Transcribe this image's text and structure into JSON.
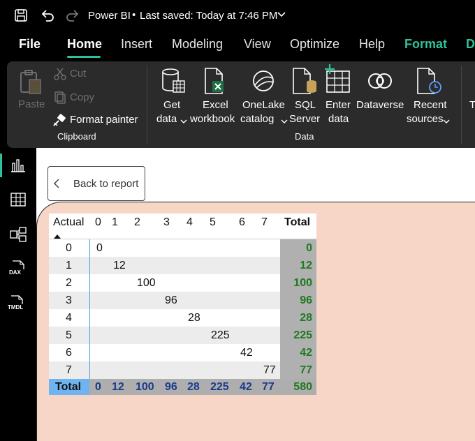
{
  "titlebar": {
    "app_title": "Power BI",
    "separator": "•",
    "saved_status": "Last saved: Today at 7:46 PM",
    "icons": [
      "save-icon",
      "undo-icon",
      "redo-icon",
      "chevron-down-icon"
    ]
  },
  "menu": {
    "items": [
      "File",
      "Home",
      "Insert",
      "Modeling",
      "View",
      "Optimize",
      "Help",
      "Format",
      "D"
    ],
    "active": "Home"
  },
  "ribbon": {
    "clipboard": {
      "paste": "Paste",
      "cut": "Cut",
      "copy": "Copy",
      "format_painter": "Format painter",
      "group": "Clipboard"
    },
    "data": {
      "get_data": [
        "Get",
        "data"
      ],
      "excel": [
        "Excel",
        "workbook"
      ],
      "onelake": [
        "OneLake",
        "catalog"
      ],
      "sql": [
        "SQL",
        "Server"
      ],
      "enter": [
        "Enter",
        "data"
      ],
      "dataverse": "Dataverse",
      "recent": [
        "Recent",
        "sources"
      ],
      "group": "Data"
    },
    "next_partial": "T"
  },
  "leftrail": {
    "icons": [
      "report-view-icon",
      "table-view-icon",
      "model-view-icon",
      "dax-query-icon",
      "tmdl-view-icon"
    ],
    "dax_text": "DAX",
    "tmdl_text": "TMDL"
  },
  "back_button": {
    "label": "Back to report"
  },
  "matrix": {
    "row_header": "Actual",
    "columns": [
      "0",
      "1",
      "2",
      "3",
      "4",
      "5",
      "6",
      "7"
    ],
    "total_label": "Total",
    "rows": [
      {
        "label": "0",
        "col": 0,
        "value": "0",
        "total": "0"
      },
      {
        "label": "1",
        "col": 1,
        "value": "12",
        "total": "12"
      },
      {
        "label": "2",
        "col": 2,
        "value": "100",
        "total": "100"
      },
      {
        "label": "3",
        "col": 3,
        "value": "96",
        "total": "96"
      },
      {
        "label": "4",
        "col": 4,
        "value": "28",
        "total": "28"
      },
      {
        "label": "5",
        "col": 5,
        "value": "225",
        "total": "225"
      },
      {
        "label": "6",
        "col": 6,
        "value": "42",
        "total": "42"
      },
      {
        "label": "7",
        "col": 7,
        "value": "77",
        "total": "77"
      }
    ],
    "column_totals": [
      "0",
      "12",
      "100",
      "96",
      "28",
      "225",
      "42",
      "77"
    ],
    "grand_total": "580"
  },
  "colors": {
    "accent": "#2ec29a",
    "ribbon_bg": "#2b2b2b",
    "visual_bg": "#f7d6c8",
    "row_total_bg": "#b0b0b0",
    "total_row_bg": "#aeaeae",
    "total_label_bg": "#6fb4f0",
    "row_total_text": "#1f7a1f",
    "col_total_text": "#1a3a8f"
  }
}
